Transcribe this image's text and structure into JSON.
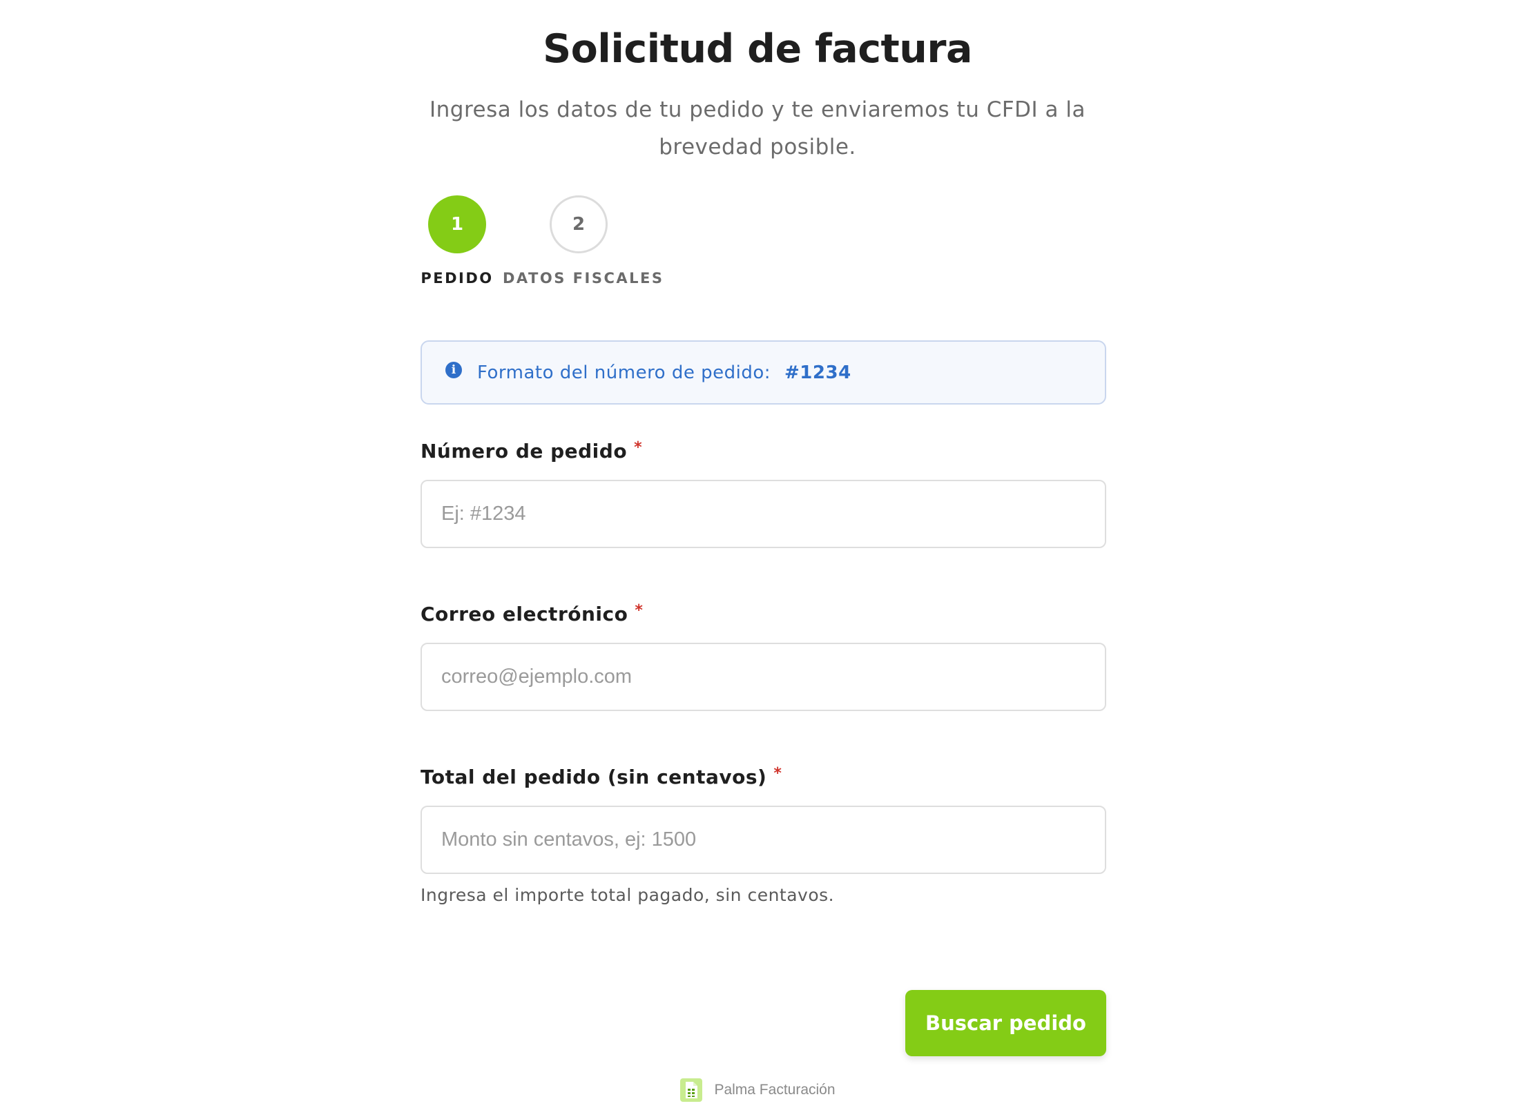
{
  "header": {
    "title": "Solicitud de factura",
    "subtitle": "Ingresa los datos de tu pedido y te enviaremos tu CFDI a la brevedad posible."
  },
  "steps": [
    {
      "number": "1",
      "label": "PEDIDO",
      "state": "active"
    },
    {
      "number": "2",
      "label": "DATOS FISCALES",
      "state": "inactive"
    }
  ],
  "info": {
    "icon": "info-icon",
    "icon_glyph": "i",
    "text": "Formato del número de pedido:",
    "code": "#1234"
  },
  "form": {
    "order_number": {
      "label": "Número de pedido",
      "required_mark": "*",
      "placeholder": "Ej: #1234",
      "value": ""
    },
    "email": {
      "label": "Correo electrónico",
      "required_mark": "*",
      "placeholder": "correo@ejemplo.com",
      "value": ""
    },
    "total": {
      "label": "Total del pedido (sin centavos)",
      "required_mark": "*",
      "placeholder": "Monto sin centavos, ej: 1500",
      "value": "",
      "help": "Ingresa el importe total pagado, sin centavos."
    },
    "submit_label": "Buscar pedido"
  },
  "footer": {
    "logo_icon": "spreadsheet-document-icon",
    "text": "Palma Facturación"
  },
  "colors": {
    "accent": "#84cc16",
    "info_blue": "#2f6fc9",
    "required_red": "#d0342c"
  }
}
